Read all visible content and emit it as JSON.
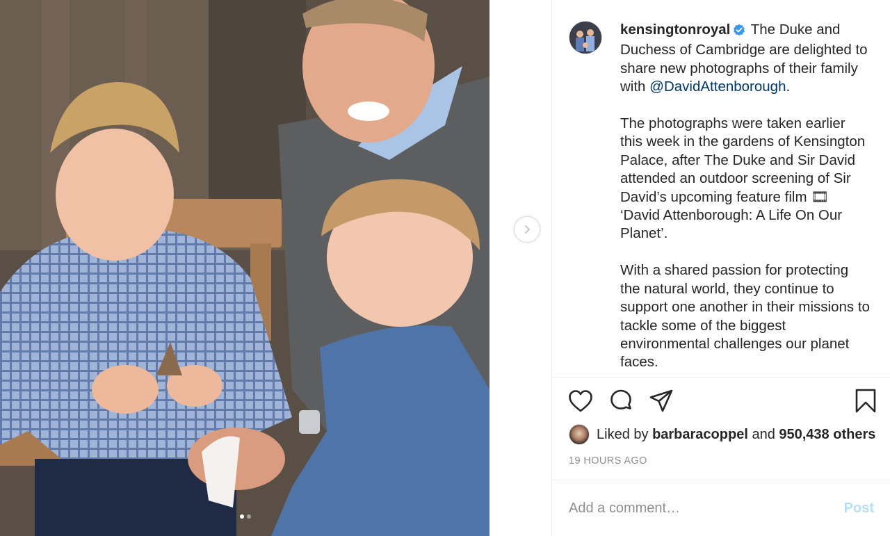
{
  "post": {
    "username": "kensingtonroyal",
    "verified_icon": "verified-badge-icon",
    "caption_intro": " The Duke and Duchess of Cambridge are delighted to share new photographs of their family with ",
    "mention": "@DavidAttenborough",
    "caption_after_mention": ".",
    "caption_para2": "The photographs were taken earlier this week in the gardens of Kensington Palace, after The Duke and Sir David attended an outdoor screening of Sir David’s upcoming feature film 🎞 ‘David Attenborough: A Life On Our Planet’.",
    "caption_para3": "With a shared passion for protecting the natural world, they continue to support one another in their missions to tackle some of the biggest environmental challenges our planet faces."
  },
  "likes": {
    "prefix": "Liked by ",
    "user": "barbaracoppel",
    "middle": " and ",
    "count": "950,438 others"
  },
  "timestamp": "19 HOURS AGO",
  "comment": {
    "placeholder": "Add a comment…",
    "post_label": "Post"
  },
  "carousel": {
    "slide_count": 2,
    "active_index": 0
  },
  "colors": {
    "link": "#00376b",
    "verified": "#3897f0",
    "post_disabled": "#b2dffc",
    "muted": "#8e8e8e"
  }
}
